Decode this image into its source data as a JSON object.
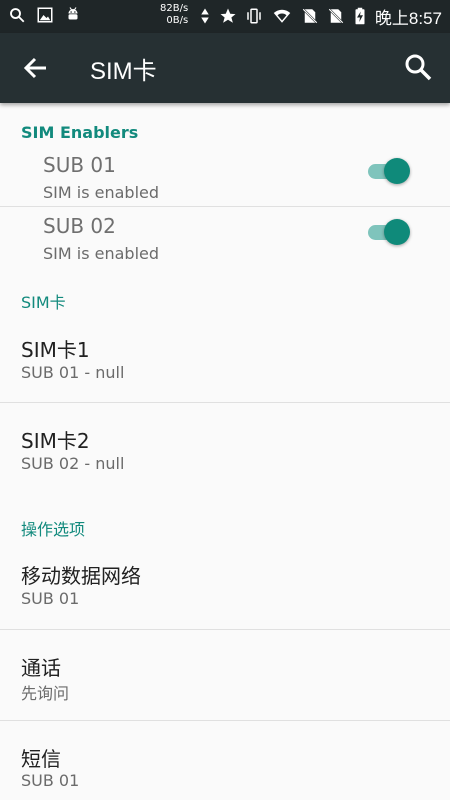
{
  "status_bar": {
    "net_up": "82B/s",
    "net_down": "0B/s",
    "time": "晚上8:57",
    "icons": [
      "search-icon",
      "image-icon",
      "android-icon",
      "arrows-icon",
      "star-icon",
      "vibrate-icon",
      "wifi-icon",
      "no-sim-icon",
      "no-sim-icon",
      "battery-charging-icon"
    ]
  },
  "appbar": {
    "title": "SIM卡",
    "back_icon": "arrow-back-icon",
    "search_icon": "search-icon"
  },
  "colors": {
    "accent": "#128a7d",
    "toggle_on": "#0f8a7a",
    "appbar": "#263033"
  },
  "sim_enablers": {
    "header": "SIM Enablers",
    "items": [
      {
        "title": "SUB 01",
        "status": "SIM is enabled",
        "enabled": true
      },
      {
        "title": "SUB 02",
        "status": "SIM is enabled",
        "enabled": true
      }
    ]
  },
  "sim_cards": {
    "header": "SIM卡",
    "items": [
      {
        "title": "SIM卡1",
        "sub": "SUB 01 - null"
      },
      {
        "title": "SIM卡2",
        "sub": "SUB 02 - null"
      }
    ]
  },
  "options": {
    "header": "操作选项",
    "items": [
      {
        "title": "移动数据网络",
        "sub": "SUB 01"
      },
      {
        "title": "通话",
        "sub": "先询问"
      },
      {
        "title": "短信",
        "sub": "SUB 01"
      }
    ]
  }
}
